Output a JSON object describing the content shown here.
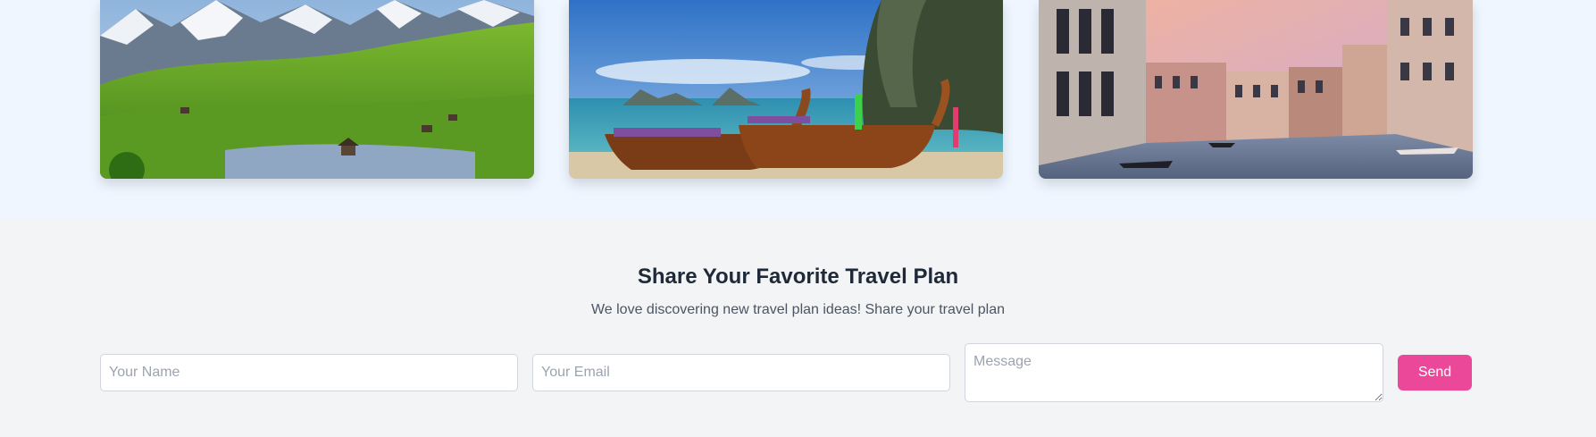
{
  "gallery": {
    "images": [
      {
        "subject": "Alpine meadow with snowy mountains and a lake"
      },
      {
        "subject": "Longtail boats on a tropical beach with limestone cliff"
      },
      {
        "subject": "Venice canal with gondolas and historic buildings"
      }
    ]
  },
  "share": {
    "title": "Share Your Favorite Travel Plan",
    "subtitle": "We love discovering new travel plan ideas! Share your travel plan",
    "name_placeholder": "Your Name",
    "email_placeholder": "Your Email",
    "message_placeholder": "Message",
    "send_label": "Send"
  },
  "colors": {
    "gallery_bg": "#eff6ff",
    "section_bg": "#f3f4f6",
    "accent": "#ec4899",
    "title": "#1f2937",
    "subtitle": "#4b5563"
  }
}
